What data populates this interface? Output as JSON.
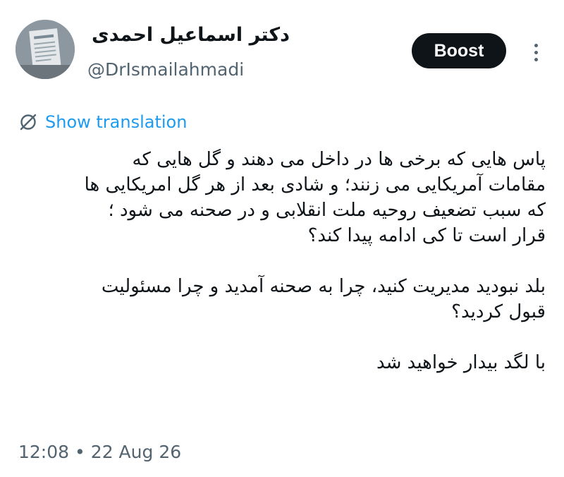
{
  "author": {
    "display_name": "دکتر اسماعیل احمدی",
    "handle": "@DrIsmailahmadi"
  },
  "actions": {
    "boost_label": "Boost",
    "more_icon": "more-vertical-icon"
  },
  "translation": {
    "label": "Show translation",
    "icon": "translate-icon"
  },
  "tweet": {
    "paragraphs": [
      {
        "lines": [
          "پاس هایی که برخی ها در داخل می دهند و گل هایی که",
          "مقامات آمریکایی می زنند؛ و شادی بعد از هر گل امریکایی ها",
          "که سبب تضعیف روحیه ملت انقلابی و در صحنه می شود ؛",
          "قرار است تا کی ادامه پیدا کند؟"
        ]
      },
      {
        "lines": [
          "بلد نبودید مدیریت کنید، چرا به صحنه آمدید و چرا مسئولیت",
          "قبول کردید؟"
        ]
      },
      {
        "lines": [
          "با لگد بیدار خواهید شد"
        ]
      }
    ]
  },
  "meta": {
    "time": "12:08",
    "separator": "•",
    "date": "22 Aug 26"
  },
  "colors": {
    "text": "#0f1419",
    "secondary": "#536471",
    "link": "#1d9bf0",
    "button_bg": "#0f1419",
    "button_text": "#ffffff"
  }
}
